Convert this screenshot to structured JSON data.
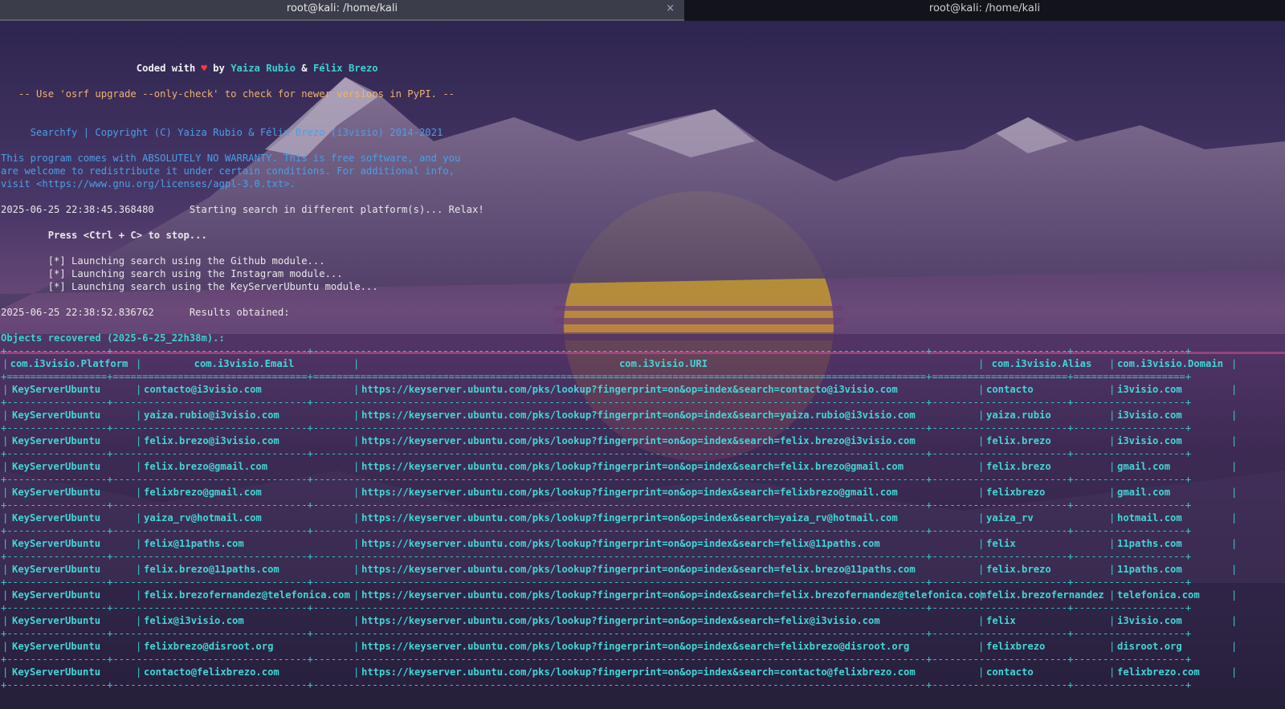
{
  "tabs": [
    {
      "title": "root@kali: /home/kali",
      "close": "×"
    },
    {
      "title": "root@kali: /home/kali"
    }
  ],
  "header": {
    "coded_prefix": "Coded with ",
    "heart": "♥",
    "by": " by ",
    "author1": "Yaiza Rubio",
    "amp": " & ",
    "author2": "Félix Brezo"
  },
  "upgrade_notice": "-- Use 'osrf upgrade --only-check' to check for newer versions in PyPI. --",
  "copyright": "Searchfy | Copyright (C) Yaiza Rubio & Félix Brezo (i3visio) 2014-2021",
  "license": [
    "This program comes with ABSOLUTELY NO WARRANTY. This is free software, and you",
    "are welcome to redistribute it under certain conditions. For additional info,",
    "visit <https://www.gnu.org/licenses/agpl-3.0.txt>."
  ],
  "start_time": "2025-06-25 22:38:45.368480",
  "start_msg": "Starting search in different platform(s)... Relax!",
  "stop_hint": "Press <Ctrl + C> to stop...",
  "launch": [
    "[*] Launching search using the Github module...",
    "[*] Launching search using the Instagram module...",
    "[*] Launching search using the KeyServerUbuntu module..."
  ],
  "result_time": "2025-06-25 22:38:52.836762",
  "result_msg": "Results obtained:",
  "objects_heading": "Objects recovered (2025-6-25_22h38m).:",
  "table": {
    "sep_line": "+-----------------+---------------------------------+--------------------------------------------------------------------------------------------------------+-----------------------+-------------------+",
    "head_sep_line": "+=================+=================================+========================================================================================================+=======================+===================+",
    "headers": [
      "com.i3visio.Platform",
      "com.i3visio.Email",
      "com.i3visio.URI",
      "com.i3visio.Alias",
      "com.i3visio.Domain"
    ],
    "rows": [
      [
        "KeyServerUbuntu",
        "contacto@i3visio.com",
        "https://keyserver.ubuntu.com/pks/lookup?fingerprint=on&op=index&search=contacto@i3visio.com",
        "contacto",
        "i3visio.com"
      ],
      [
        "KeyServerUbuntu",
        "yaiza.rubio@i3visio.com",
        "https://keyserver.ubuntu.com/pks/lookup?fingerprint=on&op=index&search=yaiza.rubio@i3visio.com",
        "yaiza.rubio",
        "i3visio.com"
      ],
      [
        "KeyServerUbuntu",
        "felix.brezo@i3visio.com",
        "https://keyserver.ubuntu.com/pks/lookup?fingerprint=on&op=index&search=felix.brezo@i3visio.com",
        "felix.brezo",
        "i3visio.com"
      ],
      [
        "KeyServerUbuntu",
        "felix.brezo@gmail.com",
        "https://keyserver.ubuntu.com/pks/lookup?fingerprint=on&op=index&search=felix.brezo@gmail.com",
        "felix.brezo",
        "gmail.com"
      ],
      [
        "KeyServerUbuntu",
        "felixbrezo@gmail.com",
        "https://keyserver.ubuntu.com/pks/lookup?fingerprint=on&op=index&search=felixbrezo@gmail.com",
        "felixbrezo",
        "gmail.com"
      ],
      [
        "KeyServerUbuntu",
        "yaiza_rv@hotmail.com",
        "https://keyserver.ubuntu.com/pks/lookup?fingerprint=on&op=index&search=yaiza_rv@hotmail.com",
        "yaiza_rv",
        "hotmail.com"
      ],
      [
        "KeyServerUbuntu",
        "felix@11paths.com",
        "https://keyserver.ubuntu.com/pks/lookup?fingerprint=on&op=index&search=felix@11paths.com",
        "felix",
        "11paths.com"
      ],
      [
        "KeyServerUbuntu",
        "felix.brezo@11paths.com",
        "https://keyserver.ubuntu.com/pks/lookup?fingerprint=on&op=index&search=felix.brezo@11paths.com",
        "felix.brezo",
        "11paths.com"
      ],
      [
        "KeyServerUbuntu",
        "felix.brezofernandez@telefonica.com",
        "https://keyserver.ubuntu.com/pks/lookup?fingerprint=on&op=index&search=felix.brezofernandez@telefonica.com",
        "felix.brezofernandez",
        "telefonica.com"
      ],
      [
        "KeyServerUbuntu",
        "felix@i3visio.com",
        "https://keyserver.ubuntu.com/pks/lookup?fingerprint=on&op=index&search=felix@i3visio.com",
        "felix",
        "i3visio.com"
      ],
      [
        "KeyServerUbuntu",
        "felixbrezo@disroot.org",
        "https://keyserver.ubuntu.com/pks/lookup?fingerprint=on&op=index&search=felixbrezo@disroot.org",
        "felixbrezo",
        "disroot.org"
      ],
      [
        "KeyServerUbuntu",
        "contacto@felixbrezo.com",
        "https://keyserver.ubuntu.com/pks/lookup?fingerprint=on&op=index&search=contacto@felixbrezo.com",
        "contacto",
        "felixbrezo.com"
      ]
    ]
  }
}
